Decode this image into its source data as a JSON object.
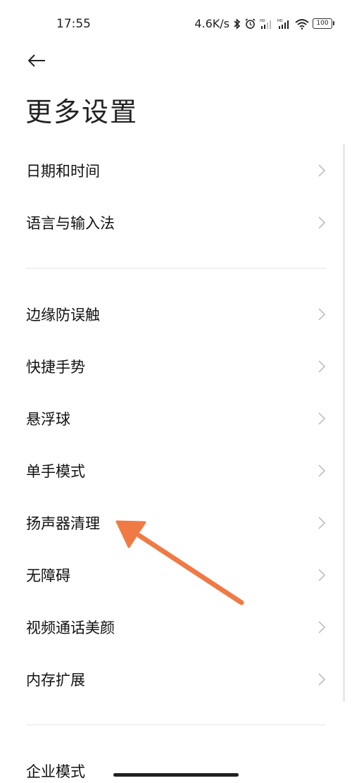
{
  "status_bar": {
    "time": "17:55",
    "net_speed": "4.6K/s",
    "battery": "100",
    "icons": [
      "bluetooth-icon",
      "alarm-icon",
      "hd-signal-icon",
      "hd-signal-icon",
      "wifi-icon",
      "battery-icon"
    ]
  },
  "header": {
    "back_icon": "back-arrow-icon",
    "title": "更多设置"
  },
  "groups": [
    {
      "items": [
        {
          "label": "日期和时间"
        },
        {
          "label": "语言与输入法"
        }
      ]
    },
    {
      "items": [
        {
          "label": "边缘防误触"
        },
        {
          "label": "快捷手势"
        },
        {
          "label": "悬浮球"
        },
        {
          "label": "单手模式"
        },
        {
          "label": "扬声器清理"
        },
        {
          "label": "无障碍"
        },
        {
          "label": "视频通话美颜"
        },
        {
          "label": "内存扩展"
        }
      ]
    },
    {
      "items": [
        {
          "label": "企业模式"
        }
      ]
    }
  ],
  "annotation": {
    "color": "#f07a45",
    "points_to": "扬声器清理"
  }
}
